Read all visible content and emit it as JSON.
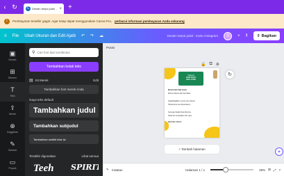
{
  "browser": {
    "tab_title": "Desain tanpa judul - Li...",
    "tab_favicon": "canva-icon",
    "tab_close": "×",
    "new_tab": "+",
    "back": "‹",
    "refresh": "↻"
  },
  "notice": {
    "icon": "!",
    "message": "Pembayaran terakhir gagal. Agar tetap dapat menggunakan Canva Pro,",
    "link": "perbarui informasi pembayaran Anda sekarang"
  },
  "topbar": {
    "menu_icon": "≡",
    "file": "File",
    "resize": "Ubah Ukuran dan Edit Ajaib",
    "undo": "↶",
    "redo": "↷",
    "cloud": "☁",
    "design_title": "Desain tanpa judul - Kartu Instagram",
    "avatar": "S",
    "add_member": "+",
    "chart_icon": "⫫",
    "share_label": "Bagikan"
  },
  "rail": [
    {
      "icon": "▣",
      "label": "Desain"
    },
    {
      "icon": "⊞",
      "label": "Elemen"
    },
    {
      "icon": "T",
      "label": "Teks"
    },
    {
      "icon": "⇪",
      "label": "Merek"
    },
    {
      "icon": "⊕",
      "label": "Unggahan"
    },
    {
      "icon": "✎",
      "label": "Gambar"
    },
    {
      "icon": "▭",
      "label": "Proyek"
    }
  ],
  "text_panel": {
    "search_placeholder": "Cari font dan kombinasi",
    "add_text_button": "Tambahkan kotak teks",
    "brand_kit": "Kit Merek",
    "brand_kit_edit": "Edit",
    "brand_fonts_button": "Tambahkan font merek Anda",
    "default_styles": "Gaya teks default",
    "heading": "Tambahkan judul",
    "subheading": "Tambahkan subjudul",
    "body": "Tambahkan sedikit teks isi",
    "recently_used": "Terakhir digunakan",
    "see_all": "Lihat semua",
    "thumb1": "Teeh",
    "thumb2": "SPIRIT"
  },
  "canvas": {
    "page_label": "Posisi",
    "page_tools": [
      "🔒",
      "⧉",
      "⊕"
    ],
    "refresh": "↻",
    "add_page": "+ Tambah halaman",
    "assist": "✦",
    "post": {
      "greeting_top": "Selamat",
      "greeting_mid": "HARI RAYA",
      "greeting_bot": "IDUL FITRI",
      "line1": "Minal Aidin Wal Faizin",
      "line2": "Mohon Maaf Lahir dan Batin",
      "line3": "Taqabbalallahu minna wa minkum",
      "line4": "Shiyamana wa shiyamakum",
      "line5": "Semoga ibadah kita diterima",
      "line6": "Selamat merayakan hari raya",
      "line7": "Idul Fitri 1444 H"
    }
  },
  "bottom": {
    "notes_icon": "✎",
    "notes": "Catatan",
    "page_counter": "Halaman 1 / 1",
    "zoom": "35%",
    "grid_icon": "⊞",
    "fullscreen_icon": "⤢",
    "help_icon": "?"
  },
  "colors": {
    "brand_purple": "#8b3dff",
    "toolbar_gradient_start": "#00c4cc",
    "notice_bg": "#fde9c9",
    "panel_bg": "#252627",
    "post_yellow": "#f5c518",
    "post_green": "#198754"
  },
  "zoom_fraction": 0.35
}
